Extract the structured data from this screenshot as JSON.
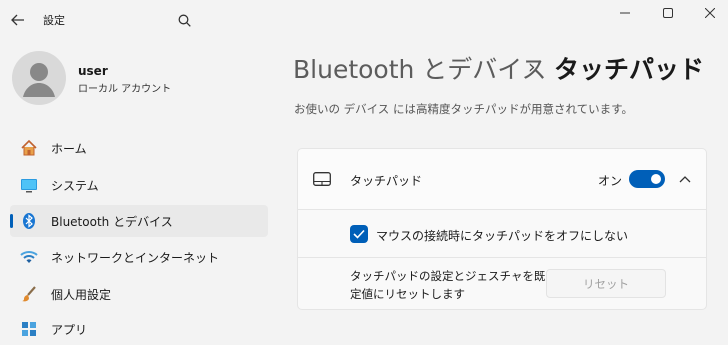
{
  "window": {
    "title": "設定",
    "controls": [
      "minimize",
      "maximize",
      "close"
    ]
  },
  "user": {
    "name": "user",
    "account_type": "ローカル アカウント"
  },
  "sidebar": {
    "items": [
      {
        "label": "ホーム",
        "icon": "home-icon"
      },
      {
        "label": "システム",
        "icon": "display-icon"
      },
      {
        "label": "Bluetooth とデバイス",
        "icon": "bluetooth-icon",
        "selected": true
      },
      {
        "label": "ネットワークとインターネット",
        "icon": "wifi-icon"
      },
      {
        "label": "個人用設定",
        "icon": "paintbrush-icon"
      },
      {
        "label": "アプリ",
        "icon": "apps-icon"
      }
    ]
  },
  "header": {
    "breadcrumb_parent": "Bluetooth とデバイス",
    "separator": "›",
    "current_page": "タッチパッド",
    "description": "お使いの デバイス には高精度タッチパッドが用意されています。"
  },
  "touchpad": {
    "label": "タッチパッド",
    "toggle_state_text": "オン",
    "toggle_on": true,
    "expanded": true,
    "keep_on_with_mouse_label": "マウスの接続時にタッチパッドをオフにしない",
    "keep_on_with_mouse_checked": true,
    "reset_description": "タッチパッドの設定とジェスチャを既定値にリセットします",
    "reset_button_label": "リセット"
  },
  "colors": {
    "accent": "#005fb8",
    "background": "#f3f3f3",
    "card": "#fbfbfb"
  }
}
